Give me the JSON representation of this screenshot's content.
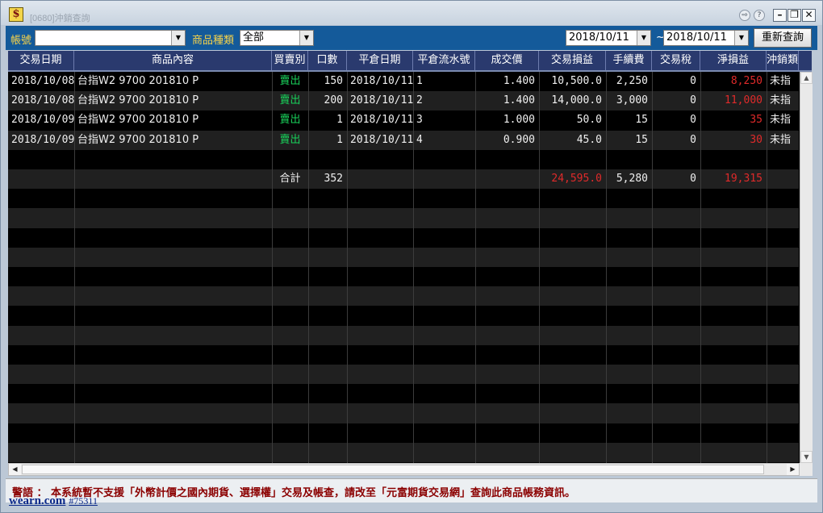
{
  "window": {
    "title": "[0680]沖銷查詢",
    "logo_glyph": "$",
    "buttons": {
      "help1": "⇨",
      "help2": "?",
      "minimize": "–",
      "restore": "❐",
      "close": "✕"
    }
  },
  "toolbar": {
    "account_label": "帳號",
    "account_value": "",
    "product_type_label": "商品種類",
    "product_type_value": "全部",
    "date_from": "2018/10/11",
    "date_separator": "~",
    "date_to": "2018/10/11",
    "requery_label": "重新查詢"
  },
  "table": {
    "columns": [
      "交易日期",
      "商品內容",
      "買賣別",
      "口數",
      "平倉日期",
      "平倉流水號",
      "成交價",
      "交易損益",
      "手續費",
      "交易稅",
      "淨損益",
      "沖銷類"
    ],
    "rows": [
      {
        "trade_date": "2018/10/08",
        "product": "台指W2 9700 201810 P",
        "side": "賣出",
        "qty": "150",
        "close_date": "2018/10/11",
        "serial": "1",
        "price": "1.400",
        "pl": "10,500.0",
        "fee": "2,250",
        "tax": "0",
        "net": "8,250",
        "type": "未指"
      },
      {
        "trade_date": "2018/10/08",
        "product": "台指W2 9700 201810 P",
        "side": "賣出",
        "qty": "200",
        "close_date": "2018/10/11",
        "serial": "2",
        "price": "1.400",
        "pl": "14,000.0",
        "fee": "3,000",
        "tax": "0",
        "net": "11,000",
        "type": "未指"
      },
      {
        "trade_date": "2018/10/09",
        "product": "台指W2 9700 201810 P",
        "side": "賣出",
        "qty": "1",
        "close_date": "2018/10/11",
        "serial": "3",
        "price": "1.000",
        "pl": "50.0",
        "fee": "15",
        "tax": "0",
        "net": "35",
        "type": "未指"
      },
      {
        "trade_date": "2018/10/09",
        "product": "台指W2 9700 201810 P",
        "side": "賣出",
        "qty": "1",
        "close_date": "2018/10/11",
        "serial": "4",
        "price": "0.900",
        "pl": "45.0",
        "fee": "15",
        "tax": "0",
        "net": "30",
        "type": "未指"
      }
    ],
    "total": {
      "label": "合計",
      "qty": "352",
      "pl": "24,595.0",
      "fee": "5,280",
      "tax": "0",
      "net": "19,315"
    }
  },
  "colors": {
    "sell": "#19d05a",
    "negative": "#e02a2a",
    "header_bg": "#2a3a6e",
    "toolbar_bg": "#145a9a",
    "label_yellow": "#f7d34a"
  },
  "footer": {
    "warning": "警語 ： 本系統暫不支援「外幣計價之國內期貨、選擇權」交易及帳查，請改至「元富期貨交易網」查詢此商品帳務資訊。"
  },
  "watermark": {
    "site": "wearn.com",
    "id": "#75311"
  }
}
